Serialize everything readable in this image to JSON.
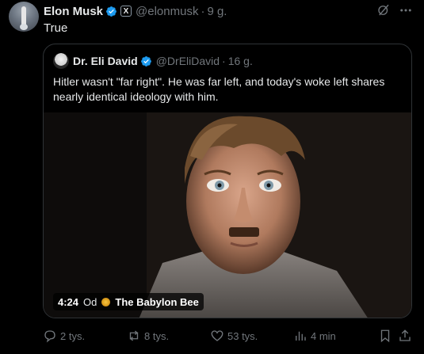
{
  "post": {
    "author_name": "Elon Musk",
    "x_badge": "X",
    "handle": "@elonmusk",
    "separator": "·",
    "time": "9 g.",
    "text": "True"
  },
  "quote": {
    "author_name": "Dr. Eli David",
    "handle": "@DrEliDavid",
    "separator": "·",
    "time": "16 g.",
    "text": "Hitler wasn't \"far right\". He was far left, and today's woke left shares nearly identical ideology with him.",
    "video": {
      "duration": "4:24",
      "from_label": "Od",
      "source": "The Babylon Bee"
    }
  },
  "actions": {
    "replies": "2 tys.",
    "reposts": "8 tys.",
    "likes": "53 tys.",
    "views": "4 min"
  },
  "colors": {
    "background": "#000000",
    "text": "#e7e9ea",
    "muted": "#71767b",
    "border": "#2f3336",
    "verified": "#1d9bf0"
  },
  "icons": [
    "verified-icon",
    "grok-icon",
    "more-icon",
    "reply-icon",
    "repost-icon",
    "like-icon",
    "views-icon",
    "bookmark-icon",
    "share-icon"
  ]
}
